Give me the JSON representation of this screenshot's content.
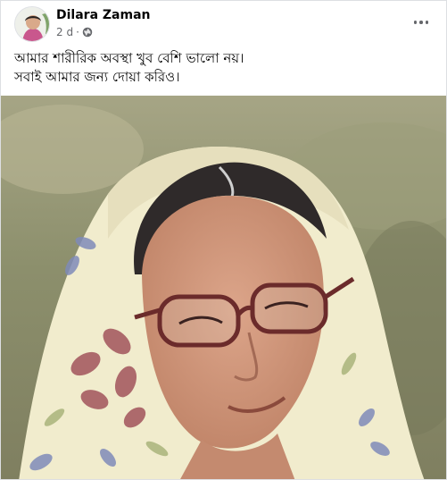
{
  "post": {
    "author": "Dilara Zaman",
    "time": "2 d",
    "dot": "·",
    "audience_icon": "globe-icon",
    "more_icon": "more-options-icon",
    "text_lines": [
      "আমার শারীরিক অবস্থা খুব বেশি ভালো নয়।",
      "সবাই আমার জন্য দোয়া করিও।"
    ]
  },
  "colors": {
    "name": "#050505",
    "meta": "#65676b",
    "background": "#ffffff",
    "feed": "#f0f2f5"
  }
}
